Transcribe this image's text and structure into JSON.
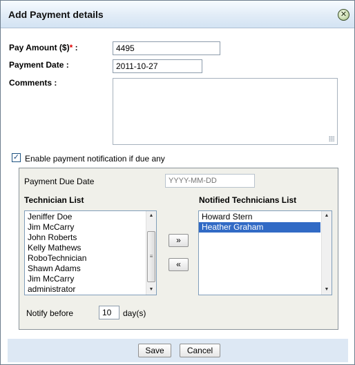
{
  "dialog": {
    "title": "Add Payment details",
    "close_icon": "close-circle-icon"
  },
  "form": {
    "pay_amount_label": "Pay Amount ($)",
    "required_mark": "*",
    "pay_amount_colon": ":",
    "pay_amount_value": "4495",
    "payment_date_label": "Payment Date :",
    "payment_date_value": "2011-10-27",
    "comments_label": "Comments :",
    "comments_value": ""
  },
  "notification": {
    "checked": true,
    "check_glyph": "✓",
    "label": "Enable payment notification if due any",
    "due_date_label": "Payment Due Date",
    "due_date_placeholder": "YYYY-MM-DD",
    "technician_list_title": "Technician List",
    "technicians": [
      "Jeniffer Doe",
      "Jim McCarry",
      "John Roberts",
      "Kelly Mathews",
      "RoboTechnician",
      "Shawn Adams",
      "Jim McCarry",
      "administrator"
    ],
    "notified_list_title": "Notified Technicians List",
    "notified": [
      {
        "name": "Howard Stern",
        "selected": false
      },
      {
        "name": "Heather Graham",
        "selected": true
      }
    ],
    "add_button_glyph": "»",
    "remove_button_glyph": "«",
    "notify_before_label": "Notify before",
    "notify_before_value": "10",
    "days_label": "day(s)"
  },
  "footer": {
    "save_label": "Save",
    "cancel_label": "Cancel"
  },
  "colors": {
    "title_bar": "#e1ecf7",
    "panel_bg": "#f0f0ea",
    "selection": "#316ac5",
    "required": "#e00000",
    "footer_bg": "#dde8f4"
  }
}
